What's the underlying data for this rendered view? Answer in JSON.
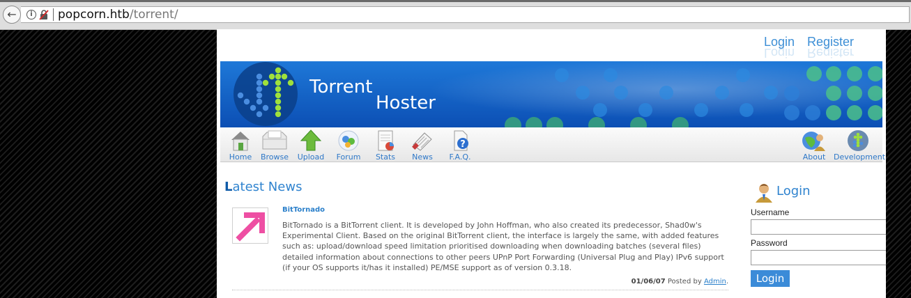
{
  "browser": {
    "url_host": "popcorn.htb",
    "url_path": "/torrent/"
  },
  "header": {
    "login_link": "Login",
    "register_link": "Register"
  },
  "banner": {
    "title_line1": "Torrent",
    "title_line2": "Hoster"
  },
  "nav": {
    "items": [
      {
        "label": "Home",
        "icon": "home-icon"
      },
      {
        "label": "Browse",
        "icon": "browse-icon"
      },
      {
        "label": "Upload",
        "icon": "upload-arrow-icon"
      },
      {
        "label": "Forum",
        "icon": "forum-icon"
      },
      {
        "label": "Stats",
        "icon": "stats-icon"
      },
      {
        "label": "News",
        "icon": "news-icon"
      },
      {
        "label": "F.A.Q.",
        "icon": "faq-icon"
      },
      {
        "label": "About",
        "icon": "about-icon"
      },
      {
        "label": "Development",
        "icon": "development-icon"
      }
    ]
  },
  "main": {
    "section_title_first": "L",
    "section_title_rest": "atest News",
    "news": [
      {
        "title": "BitTornado",
        "body": "BitTornado is a BitTorrent client. It is developed by John Hoffman, who also created its predecessor, Shad0w's Experimental Client. Based on the original BitTorrent client, the interface is largely the same, with added features such as: upload/download speed limitation prioritised downloading when downloading batches (several files) detailed information about connections to other peers UPnP Port Forwarding (Universal Plug and Play) IPv6 support (if your OS supports it/has it installed) PE/MSE support as of version 0.3.18.",
        "date": "01/06/07",
        "posted_by_label": "Posted by",
        "author": "Admin",
        "period": "."
      }
    ]
  },
  "login": {
    "heading": "Login",
    "username_label": "Username",
    "password_label": "Password",
    "username_value": "",
    "password_value": "",
    "button_label": "Login"
  },
  "colors": {
    "accent": "#2f83cf",
    "button": "#3b8bd8",
    "banner_dots": "#8fd33a"
  }
}
